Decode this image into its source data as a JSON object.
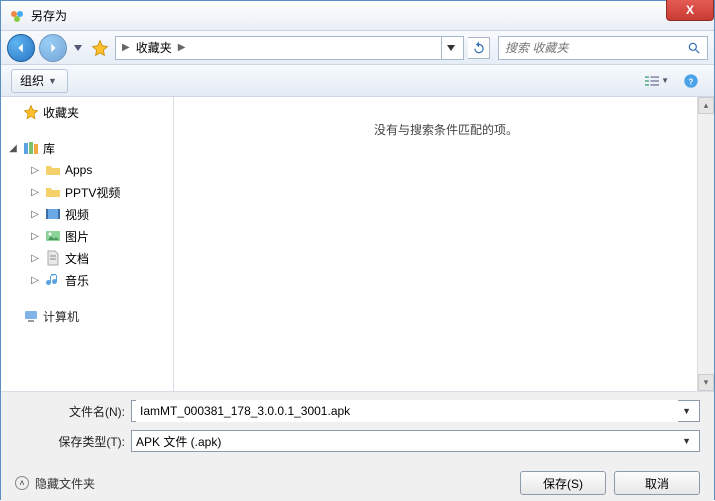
{
  "window": {
    "title": "另存为",
    "close_glyph": "X"
  },
  "nav": {
    "breadcrumb": {
      "label": "收藏夹",
      "sep": "▶"
    },
    "search_placeholder": "搜索 收藏夹"
  },
  "toolbar": {
    "organize_label": "组织"
  },
  "sidebar": {
    "favorites_label": "收藏夹",
    "libraries_label": "库",
    "computer_label": "计算机",
    "items": [
      {
        "label": "Apps"
      },
      {
        "label": "PPTV视频"
      },
      {
        "label": "视频"
      },
      {
        "label": "图片"
      },
      {
        "label": "文档"
      },
      {
        "label": "音乐"
      }
    ]
  },
  "content": {
    "empty_message": "没有与搜索条件匹配的项。"
  },
  "form": {
    "filename_label": "文件名(N):",
    "filename_value": "IamMT_000381_178_3.0.0.1_3001.apk",
    "filetype_label": "保存类型(T):",
    "filetype_value": "APK 文件 (.apk)",
    "hide_folders_label": "隐藏文件夹",
    "save_label": "保存(S)",
    "cancel_label": "取消"
  }
}
